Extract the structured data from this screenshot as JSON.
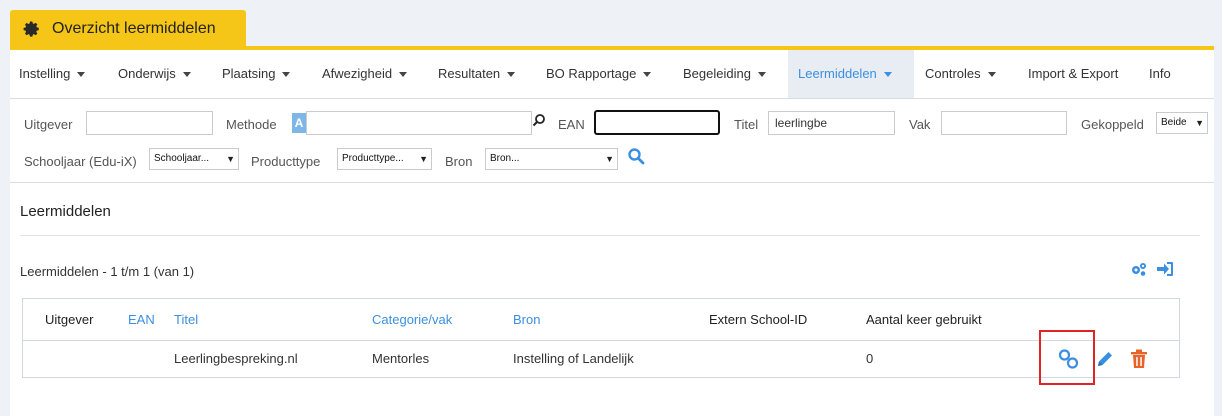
{
  "app": {
    "tab_title": "Overzicht leermiddelen"
  },
  "nav": {
    "items": [
      {
        "label": "Instelling"
      },
      {
        "label": "Onderwijs"
      },
      {
        "label": "Plaatsing"
      },
      {
        "label": "Afwezigheid"
      },
      {
        "label": "Resultaten"
      },
      {
        "label": "BO Rapportage"
      },
      {
        "label": "Begeleiding"
      },
      {
        "label": "Leermiddelen"
      },
      {
        "label": "Controles"
      },
      {
        "label": "Import & Export"
      },
      {
        "label": "Info"
      }
    ],
    "active": "Leermiddelen"
  },
  "filters": {
    "uitgever_label": "Uitgever",
    "uitgever_value": "",
    "methode_label": "Methode",
    "methode_badge": "A",
    "methode_value": "",
    "ean_label": "EAN",
    "ean_value": "",
    "titel_label": "Titel",
    "titel_value": "leerlingbe",
    "vak_label": "Vak",
    "vak_value": "",
    "gekoppeld_label": "Gekoppeld",
    "gekoppeld_value": "Beide",
    "schooljaar_label": "Schooljaar (Edu-iX)",
    "schooljaar_value": "Schooljaar...",
    "producttype_label": "Producttype",
    "producttype_value": "Producttype...",
    "bron_label": "Bron",
    "bron_value": "Bron..."
  },
  "content": {
    "section_title": "Leermiddelen",
    "list_count": "Leermiddelen - 1 t/m 1 (van 1)",
    "columns": [
      "Uitgever",
      "EAN",
      "Titel",
      "Categorie/vak",
      "Bron",
      "Extern School-ID",
      "Aantal keer gebruikt"
    ],
    "rows": [
      {
        "uitgever": "",
        "ean": "",
        "titel": "Leerlingbespreking.nl",
        "categorie": "Mentorles",
        "bron": "Instelling of Landelijk",
        "extern_id": "",
        "aantal": "0"
      }
    ]
  },
  "colors": {
    "accent_yellow": "#f5c518",
    "link_blue": "#3b8fe0",
    "delete_orange": "#e8632a",
    "highlight_red": "#e02424"
  },
  "icons": [
    "gear-icon",
    "magnifier-icon",
    "search-icon",
    "settings-cogs-icon",
    "import-icon",
    "link-icon",
    "edit-pencil-icon",
    "trash-icon"
  ]
}
